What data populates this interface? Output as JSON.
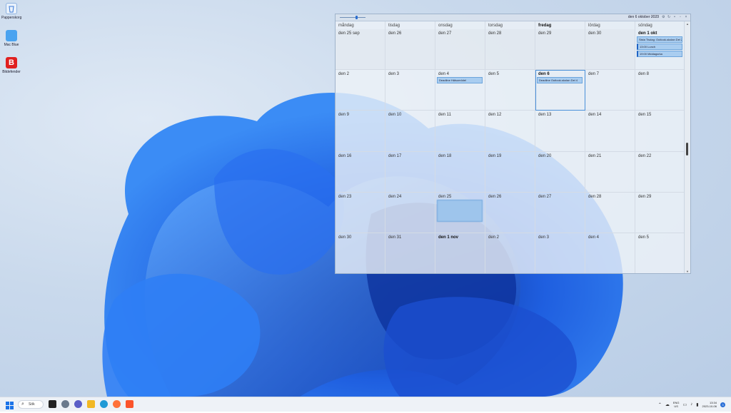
{
  "desktop": {
    "icons": [
      {
        "label": "Papperskorg",
        "icon": "recycle-bin-icon",
        "color": "#5aa0e8"
      },
      {
        "label": "Mac Blue",
        "icon": "folder-icon",
        "color": "#4aa3f0"
      },
      {
        "label": "Bitdefender",
        "icon": "bitdefender-icon",
        "color": "#e02020",
        "letter": "B"
      }
    ]
  },
  "calendar": {
    "title_date": "den 6 oktober 2023",
    "accent": "#4a90d9",
    "days": [
      "måndag",
      "tisdag",
      "onsdag",
      "torsdag",
      "fredag",
      "lördag",
      "söndag"
    ],
    "today_column": "fredag",
    "weeks": [
      [
        {
          "label": "den 25 sep",
          "prev": true
        },
        {
          "label": "den 26",
          "prev": true
        },
        {
          "label": "den 27",
          "prev": true
        },
        {
          "label": "den 28",
          "prev": true
        },
        {
          "label": "den 29",
          "prev": true
        },
        {
          "label": "den 30",
          "prev": true
        },
        {
          "label": "den 1 okt",
          "bold": true,
          "events": [
            {
              "text": "Sista Tisdag: Outlook-skolan Del 2",
              "bar": false
            },
            {
              "text": "13:00 Lunch",
              "bar": true
            },
            {
              "text": "19:00 Middagsrka",
              "bar": true
            }
          ]
        }
      ],
      [
        {
          "label": "den 2"
        },
        {
          "label": "den 3"
        },
        {
          "label": "den 4",
          "events": [
            {
              "text": "Deadline Hälsomödel",
              "bar": false
            }
          ]
        },
        {
          "label": "den 5"
        },
        {
          "label": "den 6",
          "bold": true,
          "selected": true,
          "events": [
            {
              "text": "Deadline Outlook-skolan Del 4",
              "bar": false
            }
          ]
        },
        {
          "label": "den 7"
        },
        {
          "label": "den 8"
        }
      ],
      [
        {
          "label": "den 9"
        },
        {
          "label": "den 10"
        },
        {
          "label": "den 11"
        },
        {
          "label": "den 12"
        },
        {
          "label": "den 13"
        },
        {
          "label": "den 14"
        },
        {
          "label": "den 15"
        }
      ],
      [
        {
          "label": "den 16"
        },
        {
          "label": "den 17"
        },
        {
          "label": "den 18"
        },
        {
          "label": "den 19"
        },
        {
          "label": "den 20"
        },
        {
          "label": "den 21"
        },
        {
          "label": "den 22"
        }
      ],
      [
        {
          "label": "den 23"
        },
        {
          "label": "den 24"
        },
        {
          "label": "den 25",
          "events": [
            {
              "text": "",
              "blurred": true
            }
          ]
        },
        {
          "label": "den 26"
        },
        {
          "label": "den 27"
        },
        {
          "label": "den 28"
        },
        {
          "label": "den 29"
        }
      ],
      [
        {
          "label": "den 30"
        },
        {
          "label": "den 31"
        },
        {
          "label": "den 1 nov",
          "bold": true
        },
        {
          "label": "den 2"
        },
        {
          "label": "den 3"
        },
        {
          "label": "den 4"
        },
        {
          "label": "den 5"
        }
      ]
    ]
  },
  "taskbar": {
    "search_label": "Sök",
    "apps": [
      {
        "icon": "start-icon",
        "color": "#1a73e8"
      },
      {
        "icon": "task-view-icon",
        "color": "#222222"
      },
      {
        "icon": "widgets-icon",
        "color": "#6b7a8c"
      },
      {
        "icon": "chat-icon",
        "color": "#5b5fc7"
      },
      {
        "icon": "file-explorer-icon",
        "color": "#f2b824"
      },
      {
        "icon": "edge-icon",
        "color": "#1f9ad6"
      },
      {
        "icon": "firefox-icon",
        "color": "#ff7139"
      },
      {
        "icon": "brave-icon",
        "color": "#fb542b"
      }
    ],
    "tray": {
      "language_top": "ENG",
      "language_bottom": "US",
      "time": "13:34",
      "date": "2023-10-06",
      "notifications": "3"
    }
  }
}
